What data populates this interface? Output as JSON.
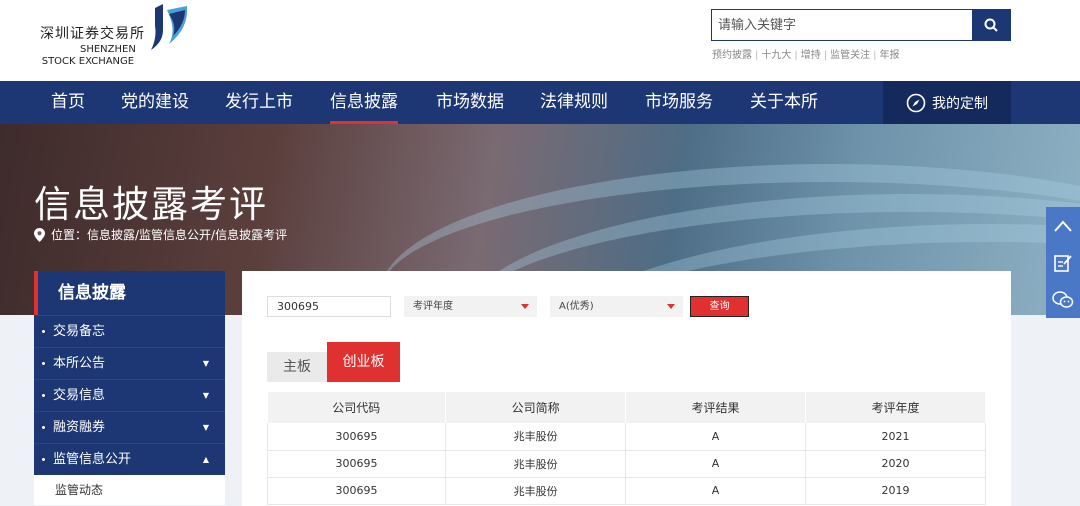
{
  "brand": {
    "name_cn": "深圳证券交易所",
    "name_en_1": "SHENZHEN",
    "name_en_2": "STOCK EXCHANGE"
  },
  "search": {
    "placeholder": "请输入关键字"
  },
  "hot": [
    "预约披露",
    "十九大",
    "增持",
    "监管关注",
    "年报"
  ],
  "nav": [
    "首页",
    "党的建设",
    "发行上市",
    "信息披露",
    "市场数据",
    "法律规则",
    "市场服务",
    "关于本所"
  ],
  "nav_active": "信息披露",
  "custom_label": "我的定制",
  "banner": {
    "title": "信息披露考评",
    "breadcrumb": "位置：信息披露/监管信息公开/信息披露考评"
  },
  "sidebar": {
    "title": "信息披露",
    "items": [
      {
        "label": "交易备忘",
        "arrow": ""
      },
      {
        "label": "本所公告",
        "arrow": "▼"
      },
      {
        "label": "交易信息",
        "arrow": "▼"
      },
      {
        "label": "融资融券",
        "arrow": "▼"
      },
      {
        "label": "监管信息公开",
        "arrow": "▲"
      }
    ],
    "sub_item": "监管动态"
  },
  "filter": {
    "code": "300695",
    "year_placeholder": "考评年度",
    "grade": "A(优秀)",
    "query": "查询"
  },
  "tabs": [
    "主板",
    "创业板"
  ],
  "table": {
    "headers": [
      "公司代码",
      "公司简称",
      "考评结果",
      "考评年度"
    ],
    "rows": [
      [
        "300695",
        "兆丰股份",
        "A",
        "2021"
      ],
      [
        "300695",
        "兆丰股份",
        "A",
        "2020"
      ],
      [
        "300695",
        "兆丰股份",
        "A",
        "2019"
      ]
    ]
  },
  "colors": {
    "navy": "#1d3674",
    "red": "#e0302f",
    "float_blue": "#4a78c6"
  }
}
